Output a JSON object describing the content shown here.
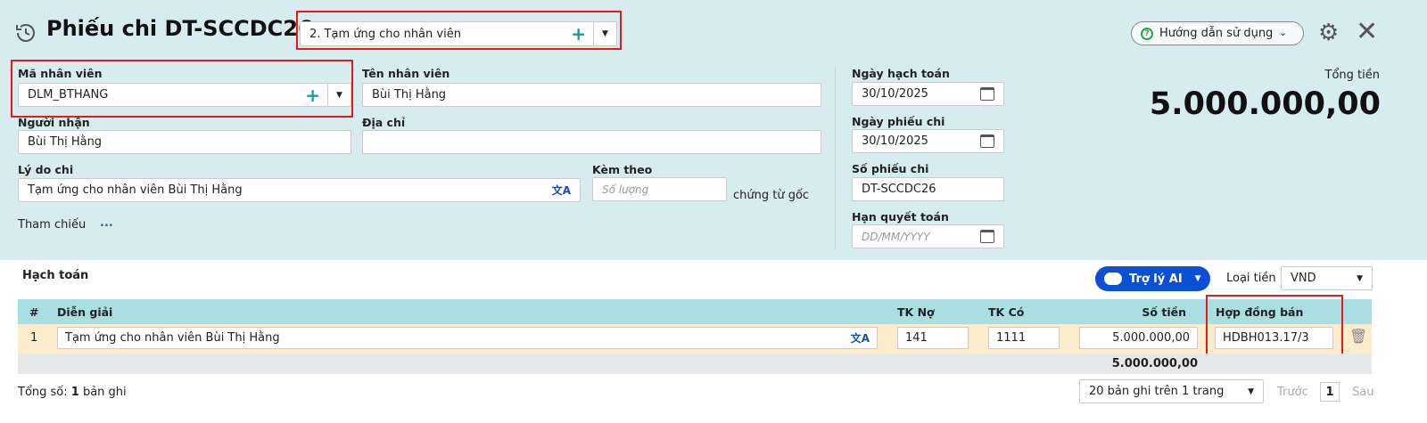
{
  "header": {
    "title": "Phiếu chi DT-SCCDC26",
    "voucher_type": "2. Tạm ứng cho nhân viên",
    "help_label": "Hướng dẫn sử dụng"
  },
  "form": {
    "employee_code_label": "Mã nhân viên",
    "employee_code": "DLM_BTHANG",
    "employee_name_label": "Tên nhân viên",
    "employee_name": "Bùi Thị Hằng",
    "receiver_label": "Người nhận",
    "receiver": "Bùi Thị Hằng",
    "address_label": "Địa chỉ",
    "address": "",
    "reason_label": "Lý do chi",
    "reason": "Tạm ứng cho nhân viên Bùi Thị Hằng",
    "attach_label": "Kèm theo",
    "attach_placeholder": "Số lượng",
    "attach_suffix": "chứng từ gốc",
    "reference_label": "Tham chiếu",
    "reference_more": "...",
    "posting_date_label": "Ngày hạch toán",
    "posting_date": "30/10/2025",
    "voucher_date_label": "Ngày phiếu chi",
    "voucher_date": "30/10/2025",
    "voucher_no_label": "Số phiếu chi",
    "voucher_no": "DT-SCCDC26",
    "settle_date_label": "Hạn quyết toán",
    "settle_date_placeholder": "DD/MM/YYYY",
    "total_label": "Tổng tiền",
    "total": "5.000.000,00"
  },
  "accounting": {
    "title": "Hạch toán",
    "ai_label": "Trợ lý AI",
    "currency_label": "Loại tiền",
    "currency": "VND",
    "columns": [
      "#",
      "Diễn giải",
      "TK Nợ",
      "TK Có",
      "Số tiền",
      "Hợp đồng bán"
    ],
    "rows": [
      {
        "no": "1",
        "desc": "Tạm ứng cho nhân viên Bùi Thị Hằng",
        "debit": "141",
        "credit": "1111",
        "amount": "5.000.000,00",
        "contract": "HDBH013.17/3"
      }
    ],
    "sum": "5.000.000,00"
  },
  "footer": {
    "total_prefix": "Tổng số: ",
    "total_count": "1",
    "total_suffix": " bản ghi",
    "page_size": "20 bản ghi trên 1 trang",
    "prev": "Trước",
    "page": "1",
    "next": "Sau"
  }
}
